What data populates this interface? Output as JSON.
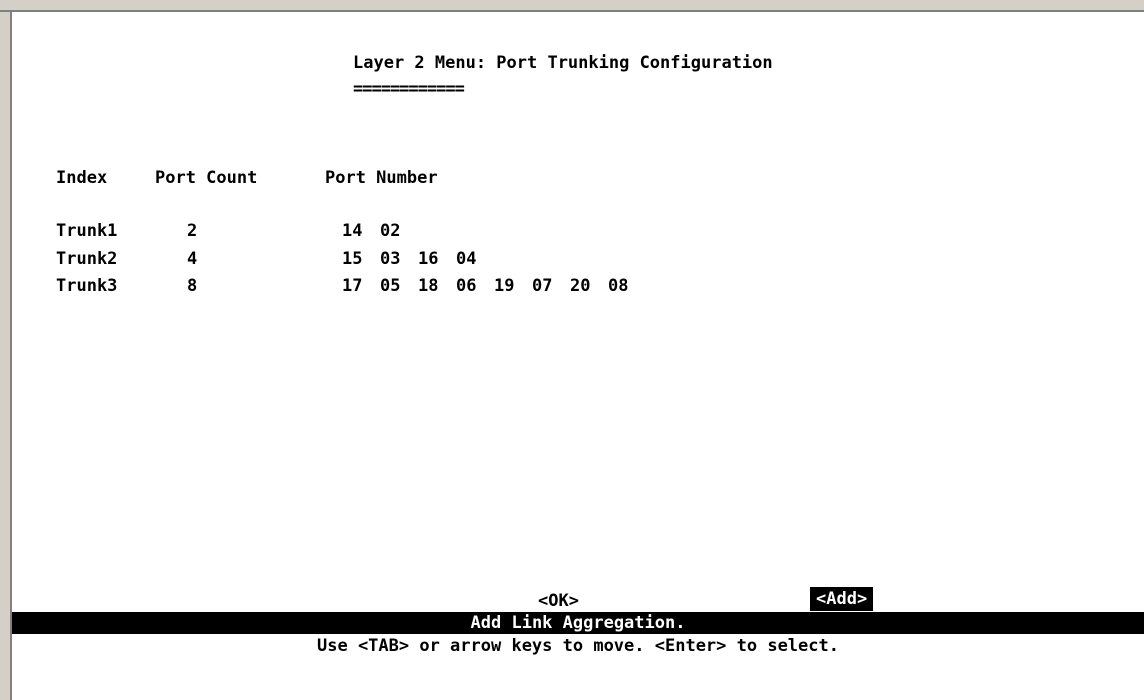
{
  "screen": {
    "title": "Layer 2 Menu: Port Trunking Configuration",
    "title_underline": "============"
  },
  "table": {
    "headers": [
      "Index",
      "Port Count",
      "Port Number"
    ],
    "rows": [
      {
        "index": "Trunk1",
        "count": "2",
        "ports": [
          "14",
          "02"
        ]
      },
      {
        "index": "Trunk2",
        "count": "4",
        "ports": [
          "15",
          "03",
          "16",
          "04"
        ]
      },
      {
        "index": "Trunk3",
        "count": "8",
        "ports": [
          "17",
          "05",
          "18",
          "06",
          "19",
          "07",
          "20",
          "08"
        ]
      }
    ]
  },
  "buttons": {
    "ok_label": "<OK>",
    "add_label": "<Add>"
  },
  "status": {
    "message": "Add Link Aggregation.",
    "help": "Use <TAB> or arrow keys to move. <Enter> to select."
  }
}
